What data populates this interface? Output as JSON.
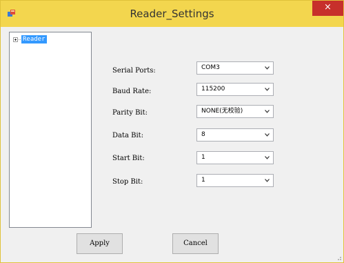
{
  "window": {
    "title": "Reader_Settings",
    "close_glyph": "×",
    "icons": {
      "app": "app-icon",
      "close": "close-icon"
    }
  },
  "tree": {
    "nodes": [
      {
        "label": "Reader",
        "expander": "plus-icon",
        "selected": true
      }
    ]
  },
  "settings": {
    "serial_ports": {
      "label": "Serial Ports:",
      "value": "COM3"
    },
    "baud_rate": {
      "label": "Baud Rate:",
      "value": "115200"
    },
    "parity_bit": {
      "label": "Parity Bit:",
      "value": "NONE(无校验)"
    },
    "data_bit": {
      "label": "Data Bit:",
      "value": "8"
    },
    "start_bit": {
      "label": "Start Bit:",
      "value": "1"
    },
    "stop_bit": {
      "label": "Stop Bit:",
      "value": "1"
    }
  },
  "buttons": {
    "apply": "Apply",
    "cancel": "Cancel"
  },
  "colors": {
    "titlebar": "#f3d64e",
    "close": "#c7302b",
    "selection": "#3399ff",
    "background": "#f0f0f0"
  }
}
